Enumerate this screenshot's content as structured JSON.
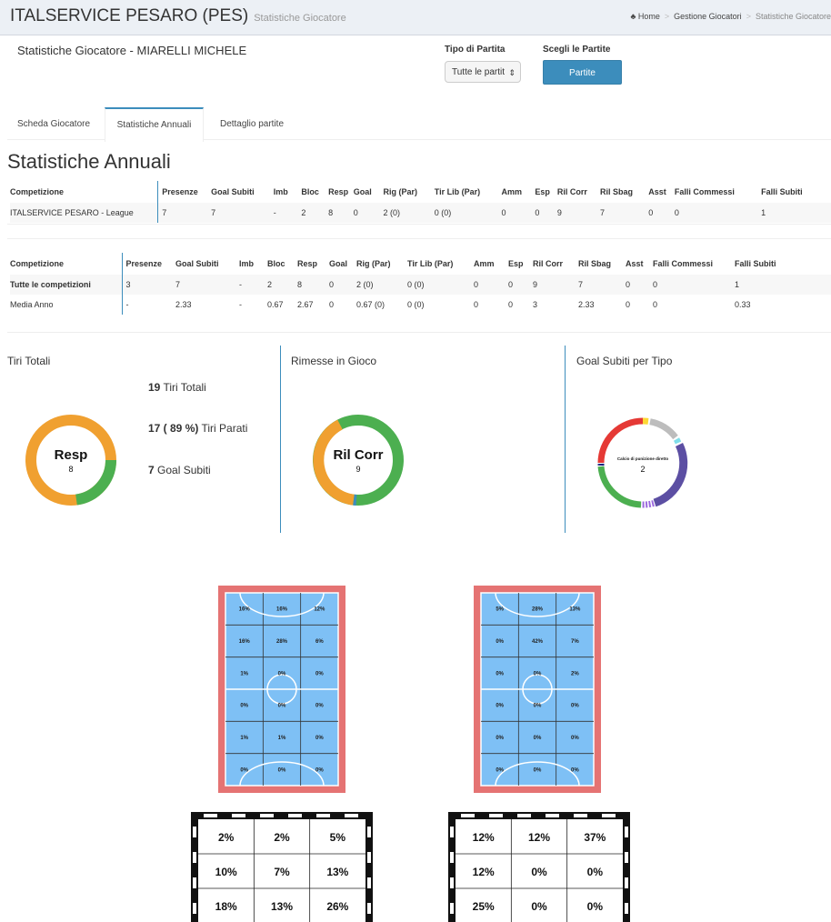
{
  "header": {
    "app_title": "ITALSERVICE PESARO (PES)",
    "page_subtitle": "Statistiche Giocatore",
    "breadcrumb": [
      "Home",
      "Gestione Giocatori",
      "Statistiche Giocatore"
    ]
  },
  "player": {
    "title": "Statistiche Giocatore - MIARELLI MICHELE"
  },
  "filters": {
    "tipo_label": "Tipo di Partita",
    "tipo_value": "Tutte le partit",
    "scegli_label": "Scegli le Partite",
    "partite_button": "Partite"
  },
  "tabs": [
    "Scheda Giocatore",
    "Statistiche Annuali",
    "Dettaglio partite"
  ],
  "section_title": "Statistiche Annuali",
  "table1": {
    "headers": [
      "Competizione",
      "Presenze",
      "Goal Subiti",
      "Imb",
      "Bloc",
      "Resp",
      "Goal",
      "Rig (Par)",
      "Tir Lib (Par)",
      "Amm",
      "Esp",
      "Ril Corr",
      "Ril Sbag",
      "Asst",
      "Falli Commessi",
      "Falli Subiti"
    ],
    "rows": [
      [
        "ITALSERVICE PESARO - League",
        "7",
        "7",
        "-",
        "2",
        "8",
        "0",
        "2 (0)",
        "0 (0)",
        "0",
        "0",
        "9",
        "7",
        "0",
        "0",
        "1"
      ]
    ]
  },
  "table2": {
    "headers": [
      "Competizione",
      "Presenze",
      "Goal Subiti",
      "Imb",
      "Bloc",
      "Resp",
      "Goal",
      "Rig (Par)",
      "Tir Lib (Par)",
      "Amm",
      "Esp",
      "Ril Corr",
      "Ril Sbag",
      "Asst",
      "Falli Commessi",
      "Falli Subiti"
    ],
    "rows": [
      [
        "Tutte le competizioni",
        "3",
        "7",
        "-",
        "2",
        "8",
        "0",
        "2 (0)",
        "0 (0)",
        "0",
        "0",
        "9",
        "7",
        "0",
        "0",
        "1"
      ],
      [
        "Media Anno",
        "-",
        "2.33",
        "-",
        "0.67",
        "2.67",
        "0",
        "0.67 (0)",
        "0 (0)",
        "0",
        "0",
        "3",
        "2.33",
        "0",
        "0",
        "0.33"
      ]
    ]
  },
  "tiri": {
    "title": "Tiri Totali",
    "totali_num": "19",
    "totali_txt": " Tiri Totali",
    "parati_num": "17 ( 89 %)",
    "parati_txt": " Tiri Parati",
    "subiti_num": "7",
    "subiti_txt": " Goal Subiti",
    "donut_label": "Resp",
    "donut_value": "8"
  },
  "rimesse": {
    "title": "Rimesse in Gioco",
    "donut_label": "Ril Corr",
    "donut_value": "9"
  },
  "goal_tipo": {
    "title": "Goal Subiti per Tipo",
    "donut_label": "Calcio di punizione diretto",
    "donut_value": "2"
  },
  "colors": {
    "orange": "#f0a030",
    "green": "#4caf50",
    "blue": "#3c8dbc",
    "court": "#7ec0f5",
    "court_border": "#e57373",
    "purple": "#5c4fa3",
    "red": "#e53935",
    "grey": "#bdbdbd"
  },
  "court_left": [
    "16%",
    "16%",
    "12%",
    "16%",
    "28%",
    "6%",
    "1%",
    "0%",
    "0%",
    "0%",
    "0%",
    "0%",
    "1%",
    "1%",
    "0%",
    "0%",
    "0%",
    "0%"
  ],
  "court_right": [
    "5%",
    "28%",
    "13%",
    "0%",
    "42%",
    "7%",
    "0%",
    "0%",
    "2%",
    "0%",
    "0%",
    "0%",
    "0%",
    "0%",
    "0%",
    "0%",
    "0%",
    "0%"
  ],
  "goal_left": [
    "2%",
    "2%",
    "5%",
    "10%",
    "7%",
    "13%",
    "18%",
    "13%",
    "26%"
  ],
  "goal_right": [
    "12%",
    "12%",
    "37%",
    "12%",
    "0%",
    "0%",
    "25%",
    "0%",
    "0%"
  ]
}
